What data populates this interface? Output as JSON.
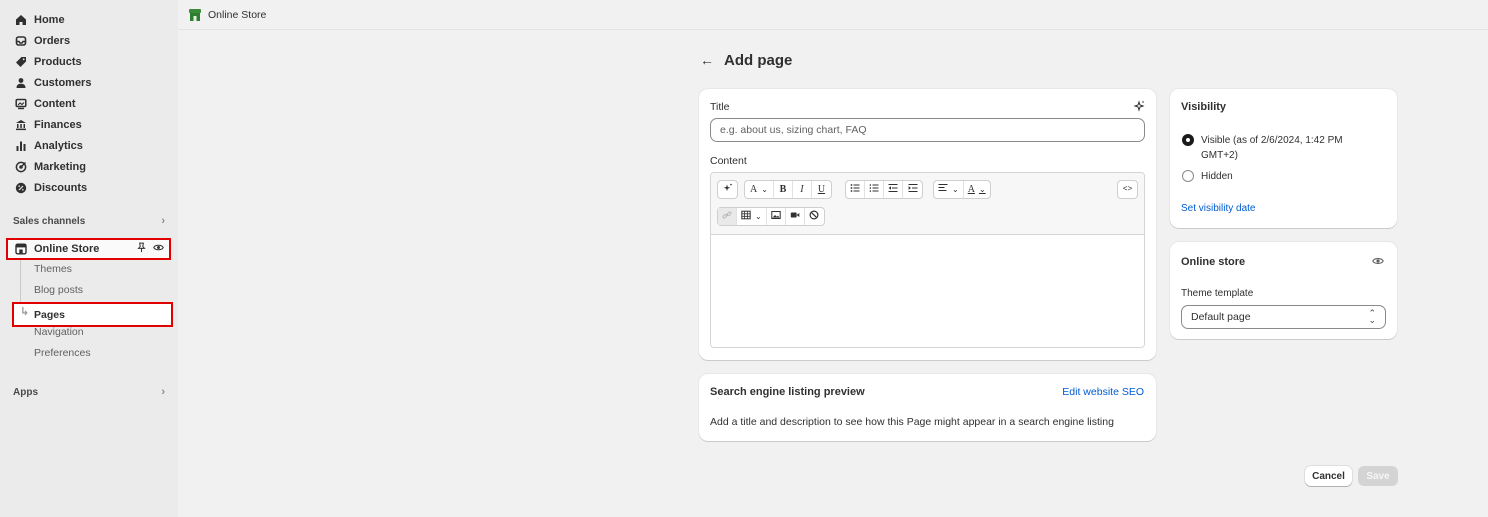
{
  "sidebar": {
    "items": [
      {
        "label": "Home",
        "icon": "home-icon"
      },
      {
        "label": "Orders",
        "icon": "inbox-icon"
      },
      {
        "label": "Products",
        "icon": "tag-icon"
      },
      {
        "label": "Customers",
        "icon": "person-icon"
      },
      {
        "label": "Content",
        "icon": "image-icon"
      },
      {
        "label": "Finances",
        "icon": "bank-icon"
      },
      {
        "label": "Analytics",
        "icon": "bar-chart-icon"
      },
      {
        "label": "Marketing",
        "icon": "target-icon"
      },
      {
        "label": "Discounts",
        "icon": "discount-icon"
      }
    ],
    "sales_channels_label": "Sales channels",
    "online_store_label": "Online Store",
    "sub_items": [
      "Themes",
      "Blog posts",
      "Pages",
      "Navigation",
      "Preferences"
    ],
    "apps_label": "Apps"
  },
  "topbar": {
    "title": "Online Store"
  },
  "page": {
    "back_icon": "arrow-left-icon",
    "title": "Add page"
  },
  "main_card": {
    "title_label": "Title",
    "title_placeholder": "e.g. about us, sizing chart, FAQ",
    "content_label": "Content",
    "content_value": ""
  },
  "seo_card": {
    "heading": "Search engine listing preview",
    "edit_link": "Edit website SEO",
    "description": "Add a title and description to see how this Page might appear in a search engine listing"
  },
  "visibility_card": {
    "heading": "Visibility",
    "visible_label": "Visible (as of 2/6/2024, 1:42 PM GMT+2)",
    "hidden_label": "Hidden",
    "selected": "Visible",
    "set_date_link": "Set visibility date"
  },
  "online_store_card": {
    "heading": "Online store",
    "template_label": "Theme template",
    "template_value": "Default page"
  },
  "actions": {
    "cancel": "Cancel",
    "save": "Save"
  },
  "colors": {
    "highlight": "#e00000",
    "link": "#005bd3",
    "save_disabled": "#d4d4d4"
  }
}
